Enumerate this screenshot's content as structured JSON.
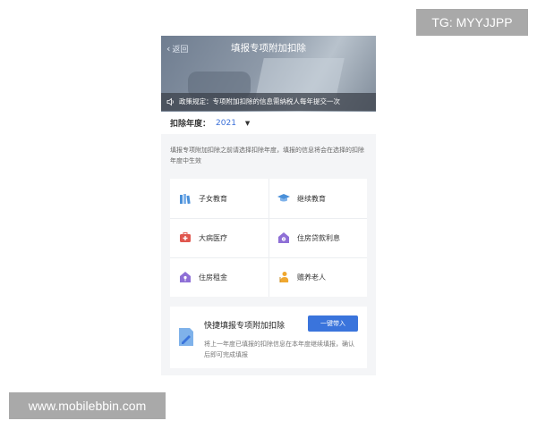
{
  "watermarks": {
    "top": "TG: MYYJJPP",
    "bottom": "www.mobilebbin.com"
  },
  "header": {
    "back_label": "返回",
    "title": "填报专项附加扣除"
  },
  "notice": {
    "icon": "speaker-icon",
    "text": "政策规定：专项附加扣除的信息需纳税人每年提交一次"
  },
  "year": {
    "label": "扣除年度：",
    "value": "2021"
  },
  "hint": "填报专项附加扣除之前请选择扣除年度，填报的信息将会在选择的扣除年度中生效",
  "items": [
    {
      "label": "子女教育",
      "icon": "books-icon",
      "color": "#4a90d9"
    },
    {
      "label": "继续教育",
      "icon": "graduation-cap-icon",
      "color": "#4a90d9"
    },
    {
      "label": "大病医疗",
      "icon": "medical-kit-icon",
      "color": "#e0574f"
    },
    {
      "label": "住房贷款利息",
      "icon": "house-coin-icon",
      "color": "#8e6fd6"
    },
    {
      "label": "住房租金",
      "icon": "house-key-icon",
      "color": "#8e6fd6"
    },
    {
      "label": "赡养老人",
      "icon": "elder-icon",
      "color": "#f0a830"
    }
  ],
  "quick": {
    "title": "快捷填报专项附加扣除",
    "button": "一键带入",
    "desc": "将上一年度已填报的扣除信息在本年度继续填报，确认后即可完成填报",
    "icon": "edit-doc-icon",
    "accent": "#3a74dc"
  }
}
